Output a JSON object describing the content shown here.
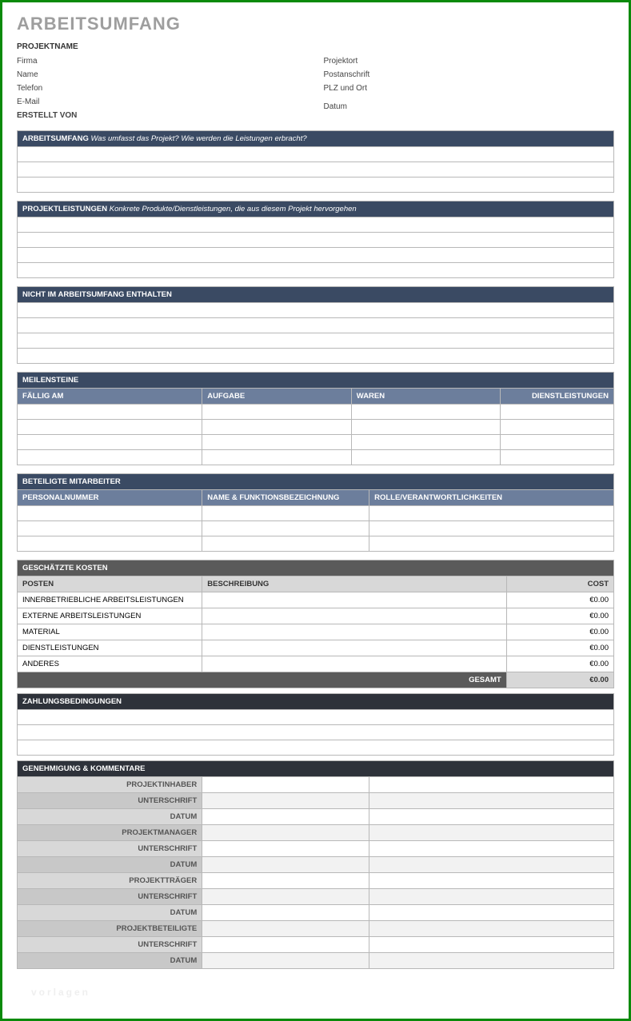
{
  "title": "ARBEITSUMFANG",
  "project_label": "PROJEKTNAME",
  "info": {
    "left": [
      "Firma",
      "Name",
      "Telefon",
      "E-Mail"
    ],
    "right": [
      "Projektort",
      "Postanschrift",
      "PLZ und Ort",
      ""
    ],
    "created_by": "ERSTELLT VON",
    "date": "Datum"
  },
  "sections": {
    "scope": {
      "title": "ARBEITSUMFANG",
      "sub": "Was umfasst das Projekt? Wie werden die Leistungen erbracht?"
    },
    "deliverables": {
      "title": "PROJEKTLEISTUNGEN",
      "sub": "Konkrete Produkte/Dienstleistungen, die aus diesem Projekt hervorgehen"
    },
    "exclusions": {
      "title": "NICHT IM ARBEITSUMFANG ENTHALTEN",
      "sub": ""
    },
    "milestones": {
      "title": "MEILENSTEINE",
      "cols": [
        "FÄLLIG AM",
        "AUFGABE",
        "WAREN",
        "DIENSTLEISTUNGEN"
      ]
    },
    "staff": {
      "title": "BETEILIGTE MITARBEITER",
      "cols": [
        "PERSONALNUMMER",
        "NAME & FUNKTIONSBEZEICHNUNG",
        "ROLLE/VERANTWORTLICHKEITEN"
      ]
    },
    "costs": {
      "title": "GESCHÄTZTE KOSTEN",
      "cols": [
        "POSTEN",
        "BESCHREIBUNG",
        "COST"
      ],
      "rows": [
        {
          "item": "INNERBETRIEBLICHE ARBEITSLEISTUNGEN",
          "cost": "€0.00"
        },
        {
          "item": "EXTERNE ARBEITSLEISTUNGEN",
          "cost": "€0.00"
        },
        {
          "item": "MATERIAL",
          "cost": "€0.00"
        },
        {
          "item": "DIENSTLEISTUNGEN",
          "cost": "€0.00"
        },
        {
          "item": "ANDERES",
          "cost": "€0.00"
        }
      ],
      "total_label": "GESAMT",
      "total": "€0.00"
    },
    "payment": {
      "title": "ZAHLUNGSBEDINGUNGEN"
    },
    "approval": {
      "title": "GENEHMIGUNG & KOMMENTARE",
      "groups": [
        [
          "PROJEKTINHABER",
          "UNTERSCHRIFT",
          "DATUM"
        ],
        [
          "PROJEKTMANAGER",
          "UNTERSCHRIFT",
          "DATUM"
        ],
        [
          "PROJEKTTRÄGER",
          "UNTERSCHRIFT",
          "DATUM"
        ],
        [
          "PROJEKTBETEILIGTE",
          "UNTERSCHRIFT",
          "DATUM"
        ]
      ]
    }
  },
  "watermark": "vorlagen"
}
